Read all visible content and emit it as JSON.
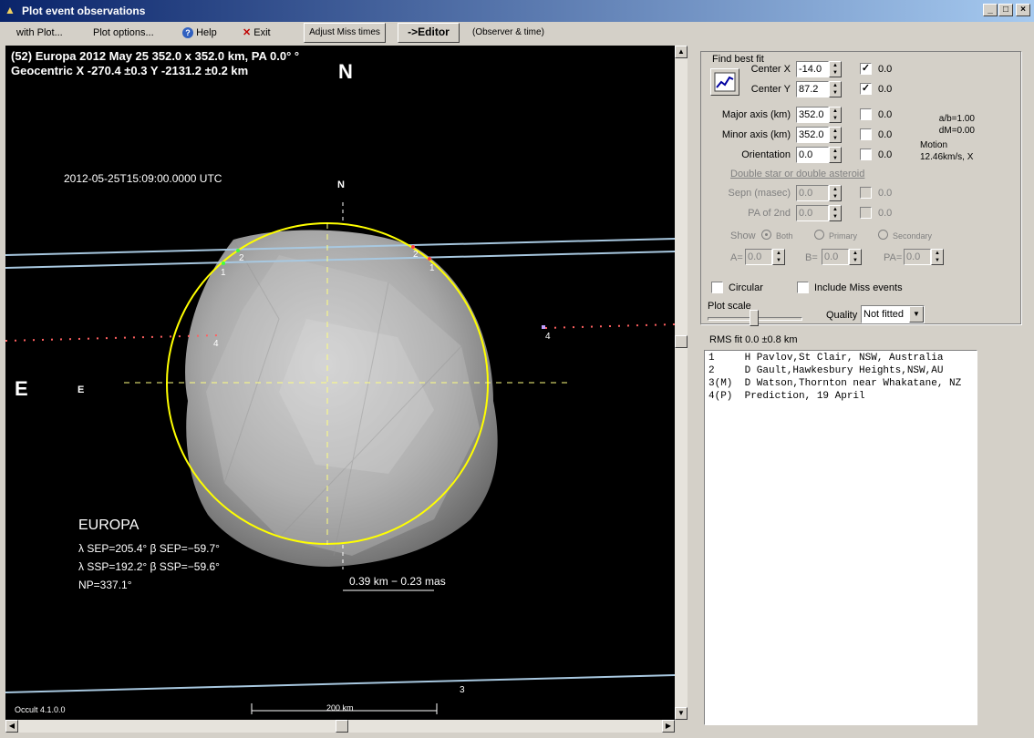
{
  "window": {
    "title": "Plot event observations"
  },
  "menu": {
    "with_plot": "with Plot...",
    "plot_options": "Plot options...",
    "help": "Help",
    "exit": "Exit",
    "adjust_miss": "Adjust Miss times",
    "editor": "->Editor",
    "observer_time": "(Observer & time)"
  },
  "plot": {
    "header_line1": "(52) Europa  2012 May 25   352.0 x 352.0 km, PA 0.0° °",
    "header_line2": "Geocentric X -270.4 ±0.3  Y -2131.2 ±0.2 km",
    "north": "N",
    "east": "E",
    "datetime": "2012-05-25T15:09:00.0000 UTC",
    "n_small": "N",
    "e_small": "E",
    "object_name": "EUROPA",
    "sep_line": "λ SEP=205.4°   β SEP=−59.7°",
    "ssp_line": "λ SSP=192.2°   β SSP=−59.6°",
    "np_line": "NP=337.1°",
    "res_line": "0.39 km  −  0.23 mas",
    "version": "Occult 4.1.0.0",
    "scale_label": "200 km",
    "chord_labels": {
      "c1a": "1",
      "c2a": "2",
      "c2b": "2",
      "c1b": "1",
      "c4a": "4",
      "c4b": "4",
      "c3": "3"
    }
  },
  "panel": {
    "group_title": "Find best fit",
    "center_x_label": "Center X",
    "center_x": "-14.0",
    "center_x_err": "0.0",
    "center_y_label": "Center Y",
    "center_y": "87.2",
    "center_y_err": "0.0",
    "major_label": "Major axis (km)",
    "major": "352.0",
    "major_err": "0.0",
    "minor_label": "Minor axis (km)",
    "minor": "352.0",
    "minor_err": "0.0",
    "orient_label": "Orientation",
    "orient": "0.0",
    "orient_err": "0.0",
    "ab_label": "a/b=1.00",
    "dm_label": "dM=0.00",
    "motion_label": "Motion",
    "motion_val": "12.46km/s, X",
    "double_title": "Double star  or  double asteroid",
    "sepn_label": "Sepn (masec)",
    "sepn": "0.0",
    "sepn_err": "0.0",
    "pa2_label": "PA of 2nd",
    "pa2": "0.0",
    "pa2_err": "0.0",
    "show_label": "Show",
    "both": "Both",
    "primary": "Primary",
    "secondary": "Secondary",
    "a_label": "A=",
    "a_val": "0.0",
    "b_label": "B=",
    "b_val": "0.0",
    "pa_label": "PA=",
    "pa_val": "0.0",
    "circular": "Circular",
    "include_miss": "Include Miss events",
    "plot_scale": "Plot scale",
    "quality_label": "Quality",
    "quality_value": "Not fitted",
    "rms": "RMS fit 0.0 ±0.8 km",
    "observers": [
      "1     H Pavlov,St Clair, NSW, Australia",
      "2     D Gault,Hawkesbury Heights,NSW,AU",
      "3(M)  D Watson,Thornton near Whakatane, NZ",
      "4(P)  Prediction, 19 April"
    ]
  },
  "colors": {
    "ellipse": "#ffff00",
    "chord": "#a8c8e0",
    "miss": "#ff6060"
  }
}
